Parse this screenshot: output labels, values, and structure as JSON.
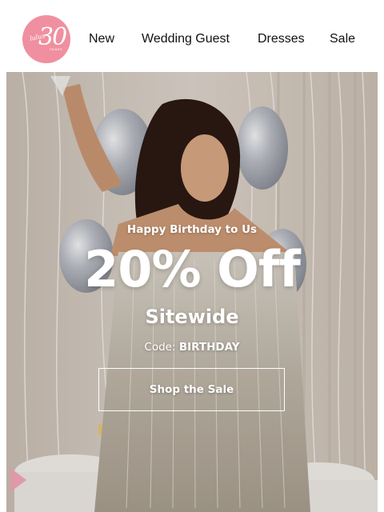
{
  "header": {
    "logo": {
      "brand_text": "lulus",
      "number": "30",
      "sub_text": "YEARS",
      "color": "#f08fa0"
    },
    "nav": [
      {
        "label": "New"
      },
      {
        "label": "Wedding Guest"
      },
      {
        "label": "Dresses"
      },
      {
        "label": "Sale"
      }
    ]
  },
  "hero": {
    "eyebrow": "Happy Birthday to Us",
    "headline": "20% Off",
    "subhead": "Sitewide",
    "code_label": "Code:",
    "code_value": "BIRTHDAY",
    "cta_label": "Shop the Sale"
  }
}
